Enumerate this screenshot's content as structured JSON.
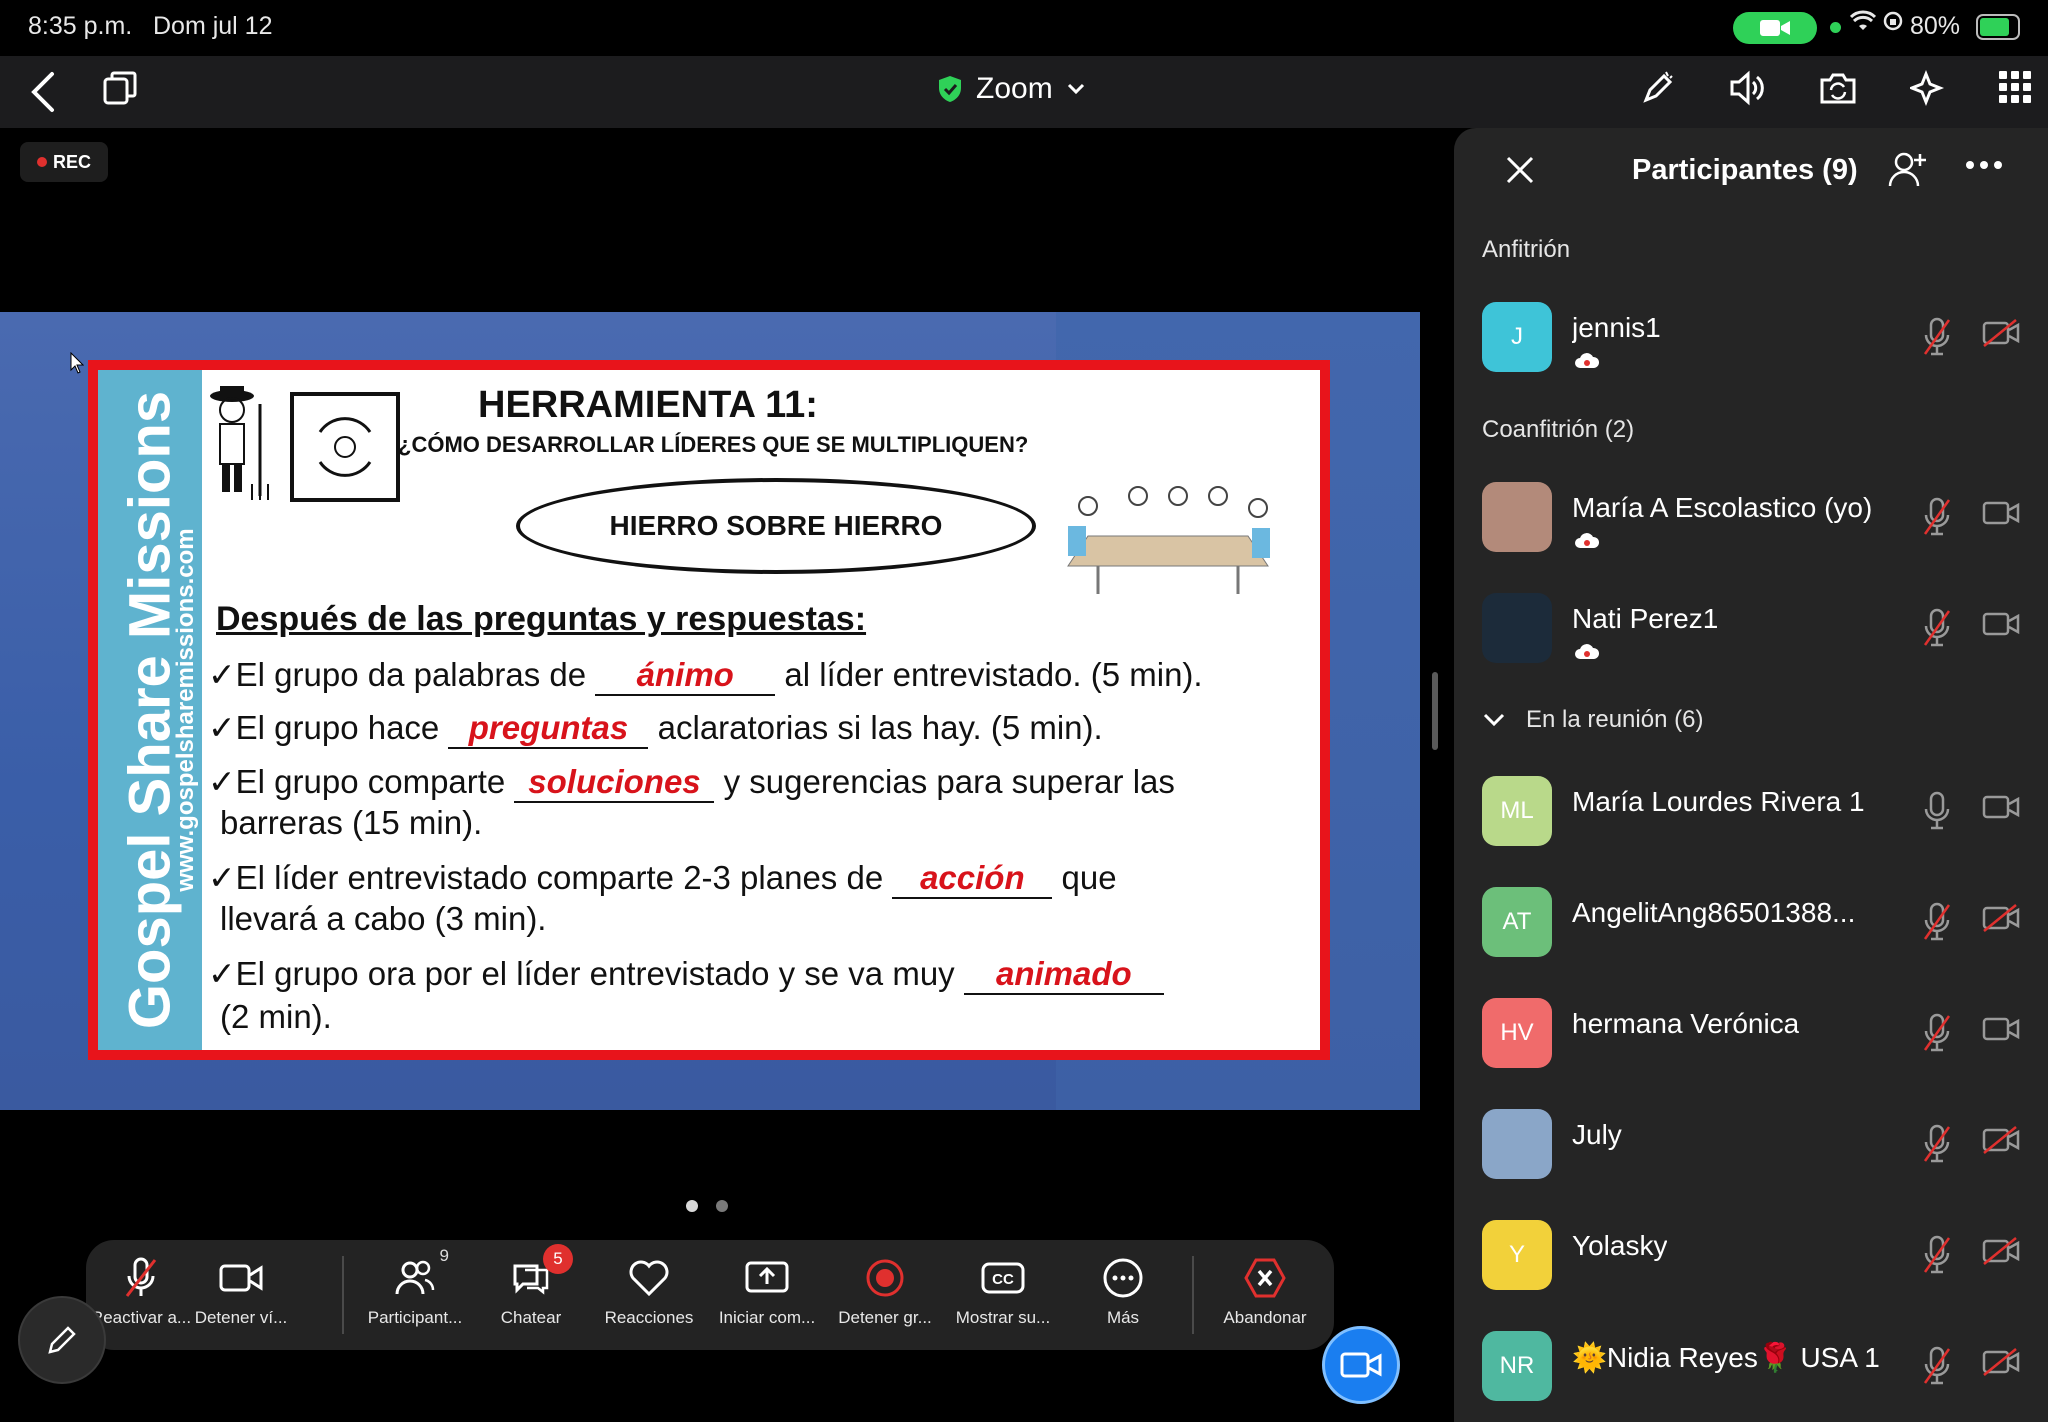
{
  "status_bar": {
    "time": "8:35 p.m.",
    "date": "Dom jul 12",
    "battery": "80%"
  },
  "top_bar": {
    "title": "Zoom",
    "colors": {
      "shield": "#2fd158"
    }
  },
  "recording_label": "REC",
  "slide": {
    "vertical_title": "Gospel Share Missions",
    "vertical_url": "www.gospelsharemissions.com",
    "title": "HERRAMIENTA 11:",
    "subtitle": "¿CÓMO DESARROLLAR LÍDERES QUE SE MULTIPLIQUEN?",
    "oval_text": "HIERRO SOBRE HIERRO",
    "heading": "Después de las preguntas y respuestas:",
    "items": [
      {
        "pre": "✓El grupo da palabras de ",
        "answer": "ánimo",
        "post": " al líder entrevistado. (5 min)."
      },
      {
        "pre": "✓El grupo hace ",
        "answer": "preguntas",
        "post": " aclaratorias si las hay. (5 min)."
      },
      {
        "pre": "✓El grupo comparte ",
        "answer": "soluciones",
        "post": " y sugerencias para superar las",
        "cont": "barreras (15 min)."
      },
      {
        "pre": "✓El líder entrevistado comparte 2-3 planes de ",
        "answer": "acción",
        "post": " que",
        "cont": "llevará a cabo (3 min)."
      },
      {
        "pre": "✓El grupo ora por el líder entrevistado y se va muy ",
        "answer": "animado",
        "post": "",
        "cont": "(2 min)."
      }
    ],
    "colors": {
      "frame": "#e8141b",
      "answer": "#d8131b",
      "band": "#5fb3cf"
    }
  },
  "pager": {
    "pages": 2,
    "current": 1
  },
  "toolbar": {
    "unmute": "Reactivar a...",
    "stop_video": "Detener ví...",
    "participants": "Participant...",
    "participants_count": "9",
    "chat": "Chatear",
    "chat_badge": "5",
    "reactions": "Reacciones",
    "share": "Iniciar com...",
    "stop_recording": "Detener gr...",
    "captions": "Mostrar su...",
    "captions_icon": "CC",
    "more": "Más",
    "leave": "Abandonar"
  },
  "panel": {
    "title": "Participantes (9)",
    "host_section": "Anfitrión",
    "cohost_section": "Coanfitrión (2)",
    "meeting_section": "En la reunión (6)",
    "host": {
      "name": "jennis1",
      "initials": "J",
      "color": "#3ec4d8",
      "mic_muted": true,
      "video_off": true
    },
    "cohosts": [
      {
        "name": "María A Escolastico (yo)",
        "initials": "",
        "color": "#b38a7a",
        "mic_muted": true,
        "video_off": false
      },
      {
        "name": "Nati Perez1",
        "initials": "",
        "color": "#1c2b3a",
        "mic_muted": true,
        "video_off": false
      }
    ],
    "attendees": [
      {
        "name": "María Lourdes Rivera 1",
        "initials": "ML",
        "color": "#b9d98a",
        "mic_muted": false,
        "video_off": false
      },
      {
        "name": "AngelitAng86501388...",
        "initials": "AT",
        "color": "#6cbf7a",
        "mic_muted": true,
        "video_off": true
      },
      {
        "name": "hermana Verónica",
        "initials": "HV",
        "color": "#f06b6b",
        "mic_muted": true,
        "video_off": false
      },
      {
        "name": "July",
        "initials": "",
        "color": "#8aa6c8",
        "mic_muted": true,
        "video_off": true
      },
      {
        "name": "Yolasky",
        "initials": "Y",
        "color": "#f2d13a",
        "mic_muted": true,
        "video_off": true
      },
      {
        "name": "🌞Nidia Reyes🌹 USA 1",
        "initials": "NR",
        "color": "#4fb8a0",
        "mic_muted": true,
        "video_off": true
      }
    ]
  }
}
